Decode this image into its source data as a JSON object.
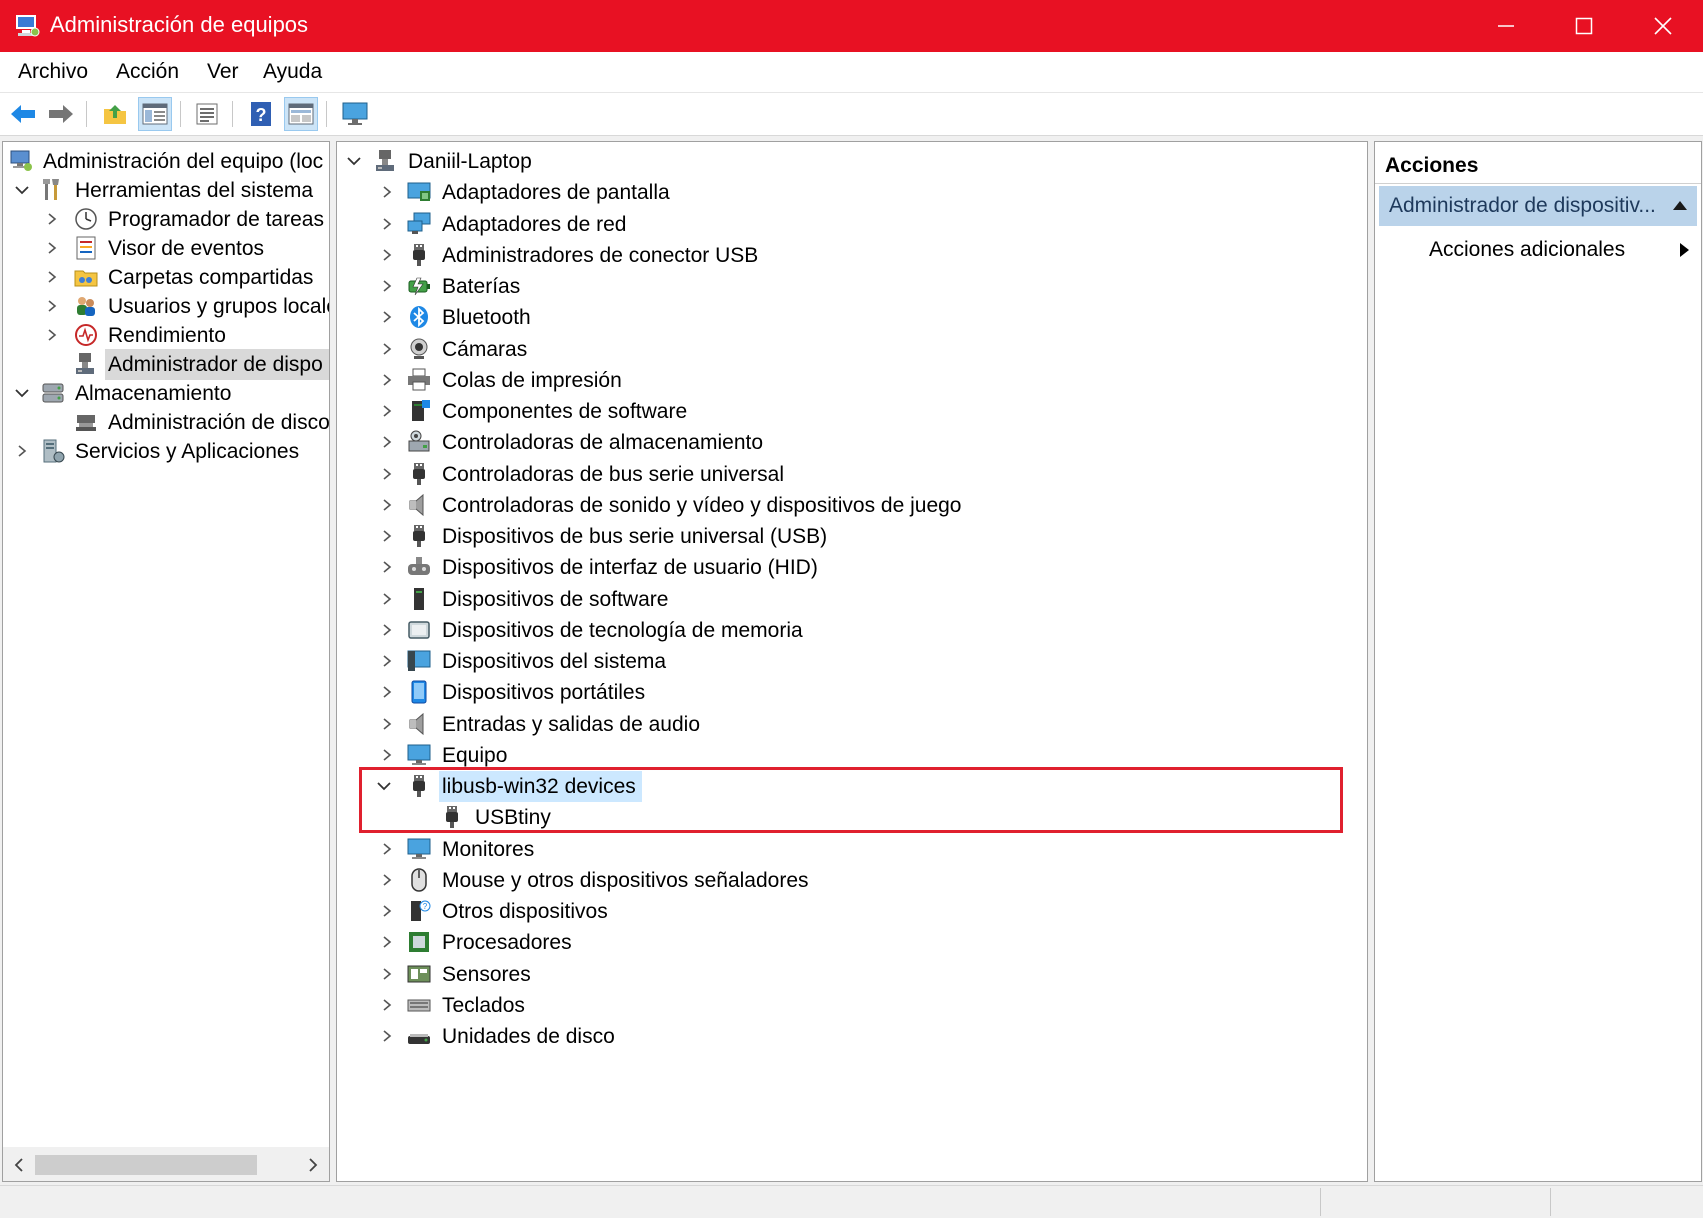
{
  "window": {
    "title": "Administración de equipos",
    "title_bar_color": "#e81123"
  },
  "menu": [
    "Archivo",
    "Acción",
    "Ver",
    "Ayuda"
  ],
  "toolbar": [
    "back-arrow-icon",
    "forward-arrow-icon",
    "up-folder-icon",
    "show-hide-tree-icon",
    "properties-icon",
    "help-icon",
    "view-icon",
    "monitor-icon"
  ],
  "left_tree": {
    "items": [
      {
        "label": "Administración del equipo (loc",
        "icon": "computer-management-icon"
      },
      {
        "label": "Herramientas del sistema",
        "icon": "tools-icon"
      },
      {
        "label": "Programador de tareas",
        "icon": "clock-icon"
      },
      {
        "label": "Visor de eventos",
        "icon": "event-viewer-icon"
      },
      {
        "label": "Carpetas compartidas",
        "icon": "shared-folder-icon"
      },
      {
        "label": "Usuarios y grupos locale",
        "icon": "users-icon"
      },
      {
        "label": "Rendimiento",
        "icon": "performance-icon"
      },
      {
        "label": "Administrador de dispo",
        "icon": "device-manager-icon"
      },
      {
        "label": "Almacenamiento",
        "icon": "storage-icon"
      },
      {
        "label": "Administración de disco",
        "icon": "disk-management-icon"
      },
      {
        "label": "Servicios y Aplicaciones",
        "icon": "services-icon"
      }
    ]
  },
  "device_tree": {
    "root": "Daniil-Laptop",
    "items": [
      {
        "label": "Adaptadores de pantalla",
        "icon": "display-adapter-icon"
      },
      {
        "label": "Adaptadores de red",
        "icon": "network-adapter-icon"
      },
      {
        "label": "Administradores de conector USB",
        "icon": "usb-plug-icon"
      },
      {
        "label": "Baterías",
        "icon": "battery-icon"
      },
      {
        "label": "Bluetooth",
        "icon": "bluetooth-icon"
      },
      {
        "label": "Cámaras",
        "icon": "camera-icon"
      },
      {
        "label": "Colas de impresión",
        "icon": "printer-icon"
      },
      {
        "label": "Componentes de software",
        "icon": "software-component-icon"
      },
      {
        "label": "Controladoras de almacenamiento",
        "icon": "storage-controller-icon"
      },
      {
        "label": "Controladoras de bus serie universal",
        "icon": "usb-plug-icon"
      },
      {
        "label": "Controladoras de sonido y vídeo y dispositivos de juego",
        "icon": "speaker-icon"
      },
      {
        "label": "Dispositivos de bus serie universal (USB)",
        "icon": "usb-plug-icon"
      },
      {
        "label": "Dispositivos de interfaz de usuario (HID)",
        "icon": "hid-icon"
      },
      {
        "label": "Dispositivos de software",
        "icon": "software-device-icon"
      },
      {
        "label": "Dispositivos de tecnología de memoria",
        "icon": "memory-icon"
      },
      {
        "label": "Dispositivos del sistema",
        "icon": "system-devices-icon"
      },
      {
        "label": "Dispositivos portátiles",
        "icon": "portable-device-icon"
      },
      {
        "label": "Entradas y salidas de audio",
        "icon": "speaker-icon"
      },
      {
        "label": "Equipo",
        "icon": "monitor-icon"
      },
      {
        "label": "libusb-win32 devices",
        "icon": "usb-plug-icon"
      },
      {
        "label": "USBtiny",
        "icon": "usb-plug-icon"
      },
      {
        "label": "Monitores",
        "icon": "monitor-icon"
      },
      {
        "label": "Mouse y otros dispositivos señaladores",
        "icon": "mouse-icon"
      },
      {
        "label": "Otros dispositivos",
        "icon": "unknown-device-icon"
      },
      {
        "label": "Procesadores",
        "icon": "processor-icon"
      },
      {
        "label": "Sensores",
        "icon": "sensor-icon"
      },
      {
        "label": "Teclados",
        "icon": "keyboard-icon"
      },
      {
        "label": "Unidades de disco",
        "icon": "disk-drive-icon"
      }
    ]
  },
  "actions": {
    "header": "Acciones",
    "section": "Administrador de dispositiv...",
    "item": "Acciones adicionales"
  },
  "colors": {
    "highlight_box": "#e0202e",
    "selection_blue": "#cce8ff",
    "actions_section_bg": "#bad3ea"
  }
}
